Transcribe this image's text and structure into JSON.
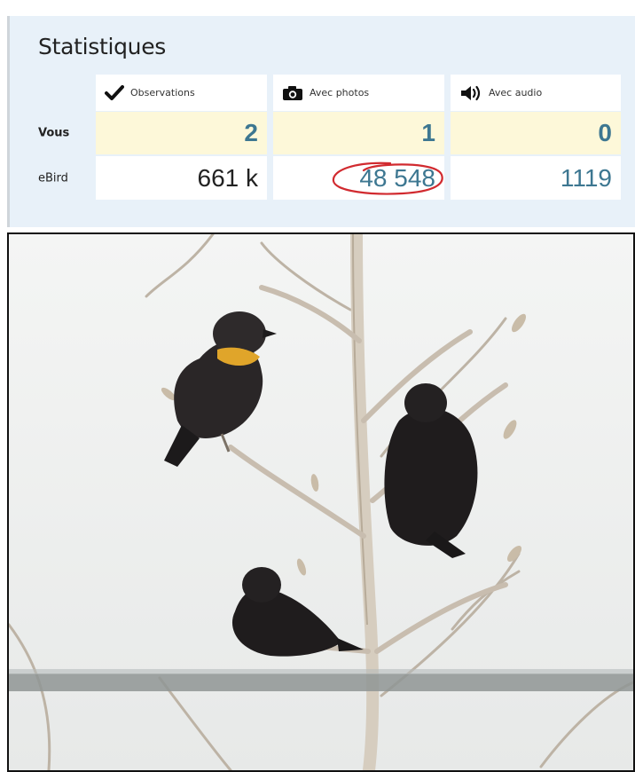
{
  "stats": {
    "title": "Statistiques",
    "columns": [
      {
        "label": "Observations",
        "icon": "checkmark-icon"
      },
      {
        "label": "Avec photos",
        "icon": "camera-icon"
      },
      {
        "label": "Avec audio",
        "icon": "speaker-icon"
      }
    ],
    "rows": [
      {
        "label": "Vous",
        "values": [
          "2",
          "1",
          "0"
        ]
      },
      {
        "label": "eBird",
        "values": [
          "661 k",
          "48 548",
          "1119"
        ]
      }
    ],
    "highlight": {
      "row": 1,
      "column": 1,
      "mark": "red hand-drawn ellipse"
    },
    "colors": {
      "panel_bg": "#e8f1f9",
      "you_row_bg": "#fdf8d9",
      "link_blue": "#3d7791",
      "mark_red": "#d12a2f"
    }
  },
  "photo": {
    "subject": "three blackbirds perched on bare branches, one with yellow throat",
    "colors": {
      "sky": "#eef0ef",
      "bird": "#1c1a1b",
      "throat": "#e0a52a",
      "branch": "#cfc6b8"
    }
  }
}
